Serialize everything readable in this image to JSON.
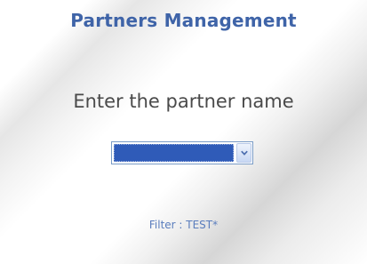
{
  "header": {
    "title": "Partners Management"
  },
  "form": {
    "prompt": "Enter the partner name",
    "partner_select": {
      "selected_value": "",
      "dropdown_icon": "chevron-down-icon"
    },
    "filter_text": "Filter : TEST*"
  },
  "colors": {
    "title": "#3f64a8",
    "selection": "#2f5bb8",
    "filter": "#5a7dbd"
  }
}
